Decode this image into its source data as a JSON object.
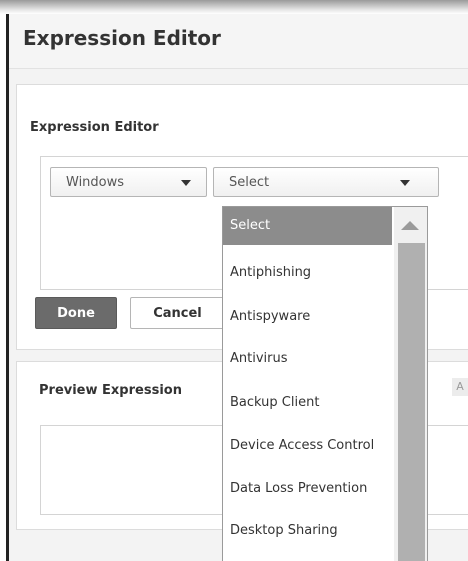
{
  "header": {
    "title": "Expression Editor"
  },
  "editor": {
    "section_title": "Expression Editor",
    "os_select": {
      "value": "Windows"
    },
    "type_select": {
      "value": "Select"
    }
  },
  "buttons": {
    "done": "Done",
    "cancel": "Cancel"
  },
  "preview": {
    "section_title": "Preview Expression"
  },
  "dropdown": {
    "selected_index": 0,
    "items": [
      "Select",
      "Antiphishing",
      "Antispyware",
      "Antivirus",
      "Backup Client",
      "Device Access Control",
      "Data Loss Prevention",
      "Desktop Sharing"
    ]
  },
  "colors": {
    "selected_bg": "#8c8c8c",
    "done_bg": "#6b6b6b"
  }
}
